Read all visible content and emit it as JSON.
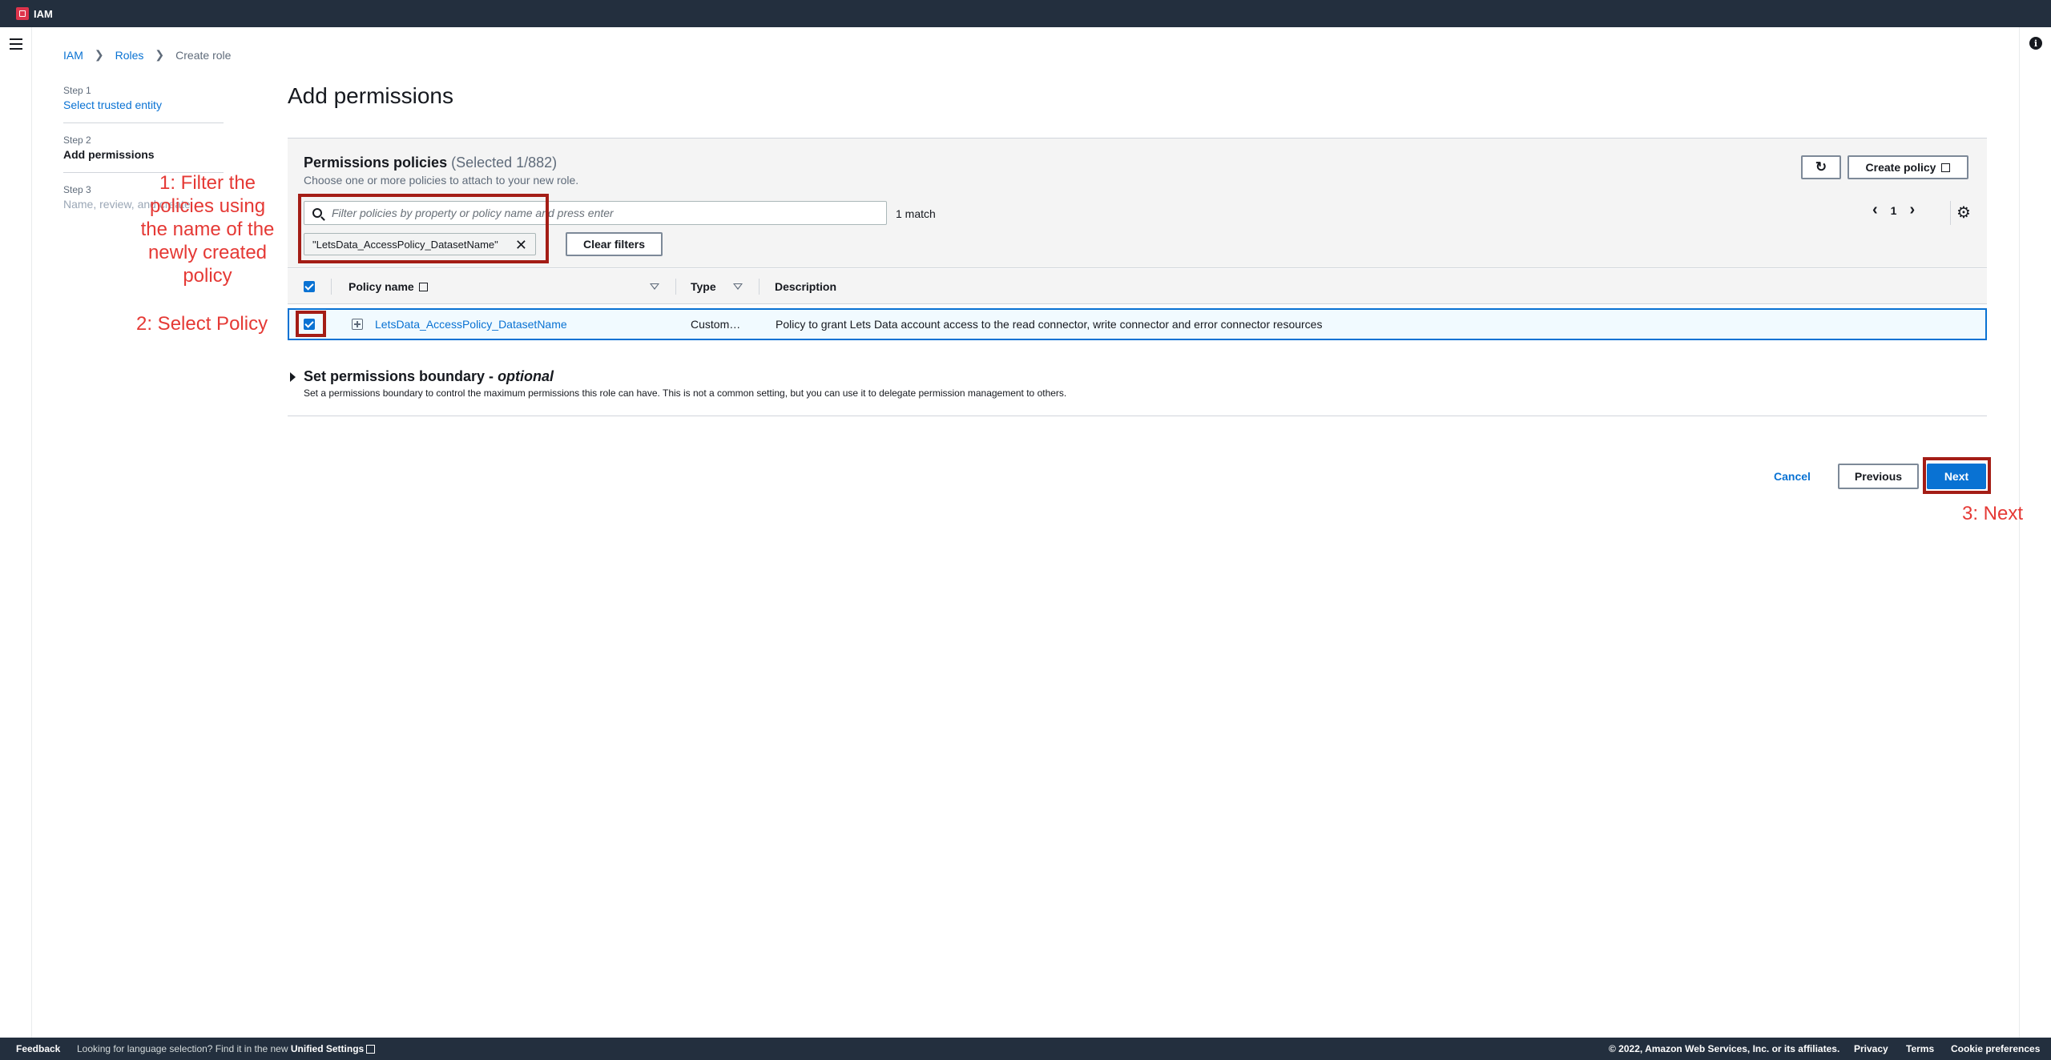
{
  "topbar": {
    "service_name": "IAM"
  },
  "breadcrumb": {
    "items": [
      "IAM",
      "Roles",
      "Create role"
    ]
  },
  "steps": [
    {
      "num": "Step 1",
      "label": "Select trusted entity"
    },
    {
      "num": "Step 2",
      "label": "Add permissions"
    },
    {
      "num": "Step 3",
      "label": "Name, review, and create"
    }
  ],
  "page": {
    "title": "Add permissions"
  },
  "policies": {
    "title": "Permissions policies",
    "selected": "(Selected 1/882)",
    "subtitle": "Choose one or more policies to attach to your new role.",
    "create_label": "Create policy",
    "search_placeholder": "Filter policies by property or policy name and press enter",
    "match": "1 match",
    "token": "\"LetsData_AccessPolicy_DatasetName\"",
    "clear_label": "Clear filters",
    "page": "1",
    "columns": [
      "Policy name",
      "Type",
      "Description"
    ],
    "rows": [
      {
        "name": "LetsData_AccessPolicy_DatasetName",
        "type": "Custom…",
        "description": "Policy to grant Lets Data account access to the read connector, write connector and error connector resources"
      }
    ]
  },
  "boundary": {
    "title": "Set permissions boundary - ",
    "title_optional": "optional",
    "subtitle": "Set a permissions boundary to control the maximum permissions this role can have. This is not a common setting, but you can use it to delegate permission management to others."
  },
  "actions": {
    "cancel": "Cancel",
    "previous": "Previous",
    "next": "Next"
  },
  "annotations": {
    "one": "1: Filter the policies using the name of the newly created policy",
    "two": "2: Select Policy",
    "three": "3: Next"
  },
  "footer": {
    "feedback": "Feedback",
    "language_msg": "Looking for language selection? Find it in the new",
    "unified": "Unified Settings",
    "copyright": "© 2022, Amazon Web Services, Inc. or its affiliates.",
    "privacy": "Privacy",
    "terms": "Terms",
    "cookies": "Cookie preferences"
  },
  "colors": {
    "accent": "#0972d3",
    "annotation": "#e53935",
    "annotation_box": "#a41d16",
    "header_bg": "#232f3e"
  }
}
